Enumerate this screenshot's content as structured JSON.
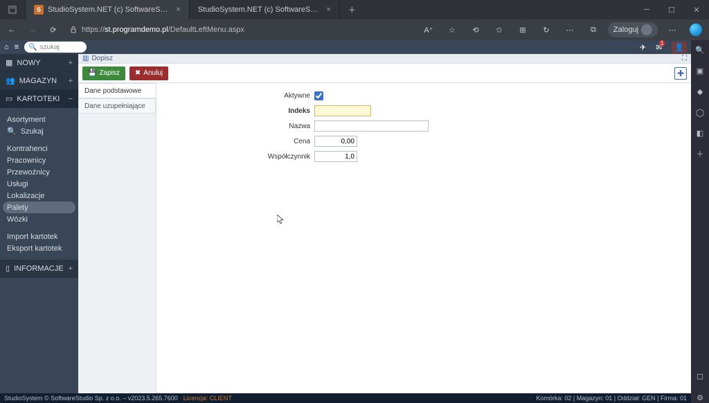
{
  "browser": {
    "tabs": [
      {
        "title": "StudioSystem.NET (c) SoftwareS…"
      },
      {
        "title": "StudioSystem.NET (c) SoftwareS…"
      }
    ],
    "url_host": "st.programdemo.pl",
    "url_path": "/DefaultLeftMenu.aspx",
    "login_label": "Zaloguj"
  },
  "appbar": {
    "search_placeholder": "szukaj",
    "mail_badge": "1"
  },
  "sidebar": {
    "cats": [
      {
        "label": "NOWY"
      },
      {
        "label": "MAGAZYN"
      },
      {
        "label": "KARTOTEKI"
      }
    ],
    "items_main": [
      "Asortyment",
      "Szukaj",
      "Kontrahenci",
      "Pracownicy",
      "Przewoźnicy",
      "Usługi",
      "Lokalizacje",
      "Palety",
      "Wózki"
    ],
    "items_io": [
      "Import kartotek",
      "Eksport kartotek"
    ],
    "cat_info": "INFORMACJE"
  },
  "page_header": {
    "title": "Dopisz"
  },
  "buttons": {
    "save": "Zapisz",
    "cancel": "Anuluj"
  },
  "form": {
    "tabs": [
      "Dane podstawowe",
      "Dane uzupełniające"
    ],
    "labels": {
      "aktywne": "Aktywne",
      "indeks": "Indeks",
      "nazwa": "Nazwa",
      "cena": "Cena",
      "wsp": "Współczynnik"
    },
    "values": {
      "cena": "0,00",
      "wsp": "1,0"
    }
  },
  "footer": {
    "copyright": "StudioSystem © SoftwareStudio Sp. z o.o. – v2023.5.265.7600",
    "license": "Licencja: CLIENT",
    "status": "Komórka: 02 | Magazyn: 01 | Oddział: GEN | Firma: 01"
  }
}
